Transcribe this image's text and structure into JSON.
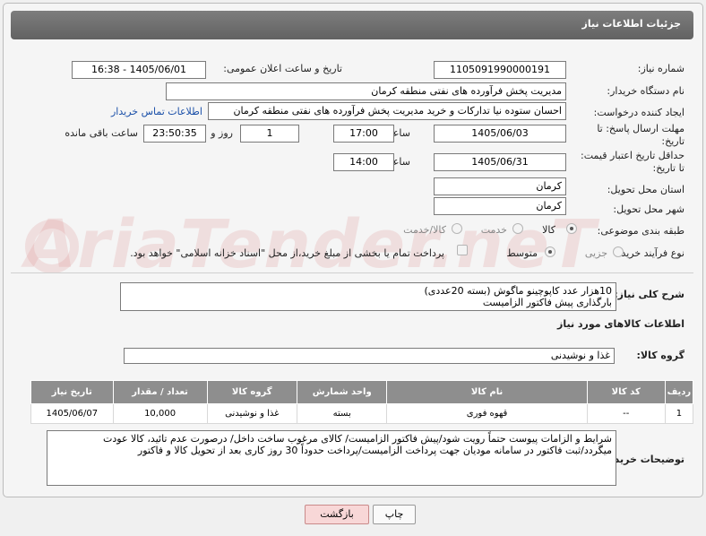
{
  "header": {
    "title": "جزئیات اطلاعات نیاز"
  },
  "watermark": "AriaTender.neT",
  "fields": {
    "need_number_label": "شماره نیاز:",
    "need_number": "1105091990000191",
    "announce_label": "تاریخ و ساعت اعلان عمومی:",
    "announce_value": "1405/06/01 - 16:38",
    "buyer_org_label": "نام دستگاه خریدار:",
    "buyer_org": "مدیریت پخش فرآورده های نفتی منطقه کرمان",
    "requester_label": "ایجاد کننده درخواست:",
    "requester": "احسان  ستوده نیا  تدارکات و خرید  مدیریت پخش فرآورده های نفتی منطقه کرمان",
    "contact_link": "اطلاعات تماس خریدار",
    "deadline_label_1": "مهلت ارسال پاسخ: تا",
    "deadline_label_2": "تاریخ:",
    "deadline_date": "1405/06/03",
    "time_label": "ساعت",
    "deadline_time": "17:00",
    "days_value": "1",
    "days_label": "روز و",
    "remaining_time": "23:50:35",
    "remaining_label": "ساعت باقی مانده",
    "validity_label_1": "حداقل تاریخ اعتبار قیمت:",
    "validity_label_2": "تا تاریخ:",
    "validity_date": "1405/06/31",
    "validity_time": "14:00",
    "province_label": "استان محل تحویل:",
    "province": "کرمان",
    "city_label": "شهر محل تحویل:",
    "city": "کرمان",
    "category_label": "طبقه بندی موضوعی:",
    "category_options": [
      "کالا",
      "خدمت",
      "کالا/خدمت"
    ],
    "process_label": "نوع فرآیند خرید :",
    "process_options": [
      "جزیی",
      "متوسط"
    ],
    "payment_note": "پرداخت تمام یا بخشی از مبلغ خرید،از محل \"اسناد خزانه اسلامی\" خواهد بود."
  },
  "description": {
    "label": "شرح کلی نیاز:",
    "line1": "10هزار عدد کاپوچینو ماگوش (بسته 20عددی)",
    "line2": "بارگذاری پیش فاکتور الزامیست"
  },
  "goods": {
    "section_title": "اطلاعات کالاهای مورد نیاز",
    "group_label": "گروه کالا:",
    "group_value": "غذا و نوشیدنی",
    "columns": [
      "ردیف",
      "کد کالا",
      "نام کالا",
      "واحد شمارش",
      "گروه کالا",
      "تعداد / مقدار",
      "تاریخ نیاز"
    ],
    "rows": [
      [
        "1",
        "--",
        "قهوه فوری",
        "بسته",
        "غذا و نوشیدنی",
        "10,000",
        "1405/06/07"
      ]
    ]
  },
  "buyer_notes": {
    "label": "توضیحات خریدار:",
    "line1": "شرایط و الزامات پیوست حتماً رویت شود/پیش فاکتور الزامیست/ کالای مرغوب ساخت داخل/ درصورت عدم تائید، کالا عودت",
    "line2": "میگردد/ثبت فاکتور در سامانه مودیان جهت پرداخت الزامیست/پرداخت حدوداً 30 روز کاری بعد از تحویل کالا و فاکتور"
  },
  "buttons": {
    "print": "چاپ",
    "back": "بازگشت"
  }
}
